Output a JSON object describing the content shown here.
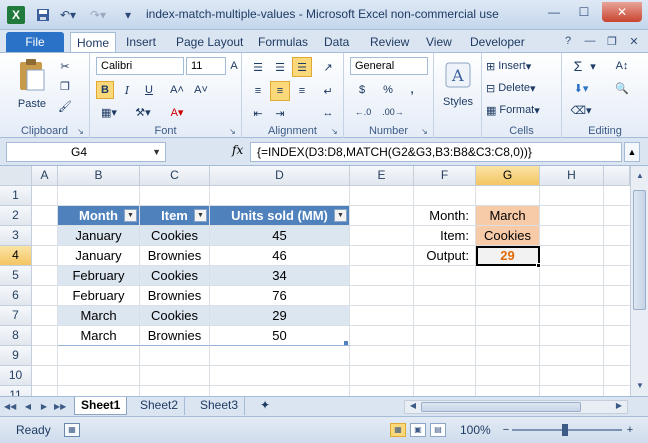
{
  "window": {
    "title": "index-match-multiple-values  -  Microsoft Excel non-commercial use",
    "min": "—",
    "max": "☐",
    "close": "✕"
  },
  "tabs": [
    "File",
    "Home",
    "Insert",
    "Page Layout",
    "Formulas",
    "Data",
    "Review",
    "View",
    "Developer"
  ],
  "ribbon": {
    "clipboard": {
      "label": "Clipboard",
      "paste": "Paste"
    },
    "font": {
      "label": "Font",
      "name": "Calibri",
      "size": "11",
      "bold": "B",
      "italic": "I",
      "underline": "U"
    },
    "alignment": {
      "label": "Alignment"
    },
    "number": {
      "label": "Number",
      "format": "General",
      "currency": "$",
      "percent": "%",
      "comma": ","
    },
    "styles": {
      "label": "Styles"
    },
    "cells": {
      "label": "Cells",
      "insert": "Insert",
      "delete": "Delete",
      "format": "Format"
    },
    "editing": {
      "label": "Editing",
      "sum": "Σ"
    }
  },
  "formula_bar": {
    "name_box": "G4",
    "fx": "fx",
    "formula": "{=INDEX(D3:D8,MATCH(G2&G3,B3:B8&C3:C8,0))}"
  },
  "columns": [
    "A",
    "B",
    "C",
    "D",
    "E",
    "F",
    "G",
    "H"
  ],
  "rows": [
    "1",
    "2",
    "3",
    "4",
    "5",
    "6",
    "7",
    "8",
    "9",
    "10",
    "11"
  ],
  "table": {
    "headers": [
      "Month",
      "Item",
      "Units sold (MM)"
    ],
    "rows": [
      [
        "January",
        "Cookies",
        "45"
      ],
      [
        "January",
        "Brownies",
        "46"
      ],
      [
        "February",
        "Cookies",
        "34"
      ],
      [
        "February",
        "Brownies",
        "76"
      ],
      [
        "March",
        "Cookies",
        "29"
      ],
      [
        "March",
        "Brownies",
        "50"
      ]
    ]
  },
  "lookup": {
    "month_label": "Month:",
    "month_value": "March",
    "item_label": "Item:",
    "item_value": "Cookies",
    "output_label": "Output:",
    "output_value": "29"
  },
  "sheets": [
    "Sheet1",
    "Sheet2",
    "Sheet3"
  ],
  "status": {
    "ready": "Ready",
    "zoom": "100%",
    "zoom_out": "−",
    "zoom_in": "+"
  },
  "colors": {
    "header_fill": "#4f81bd",
    "band_fill": "#dce6f1",
    "input_fill": "#f8cba8",
    "output_text": "#e26b0a"
  }
}
